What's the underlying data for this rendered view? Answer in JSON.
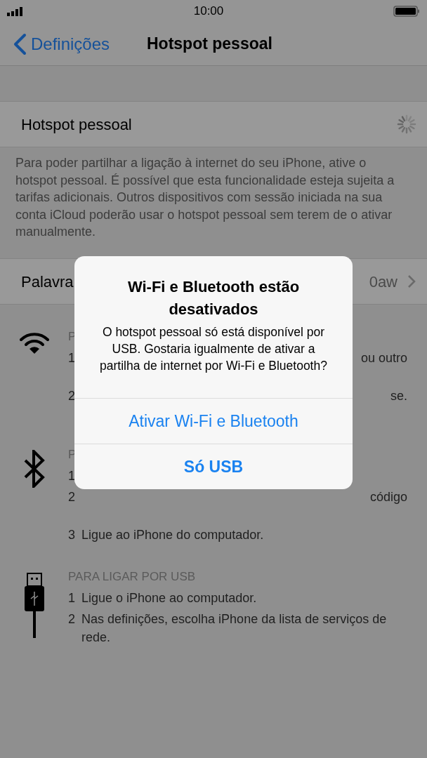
{
  "status_bar": {
    "time": "10:00"
  },
  "nav": {
    "back": "Definições",
    "title": "Hotspot pessoal"
  },
  "hotspot_cell": {
    "label": "Hotspot pessoal"
  },
  "description": "Para poder partilhar a ligação à internet do seu iPhone, ative o hotspot pessoal. É possível que esta funcionalidade esteja sujeita a tarifas adicionais. Outros dispositivos com sessão iniciada na sua conta iCloud poderão usar o hotspot pessoal sem terem de o ativar manualmente.",
  "password_cell": {
    "label": "Palavra",
    "value": "0aw"
  },
  "sections": [
    {
      "kind": "wifi",
      "items": [
        {
          "kind": "heading",
          "text": "P"
        },
        {
          "kind": "step",
          "number": "1",
          "end": "ou outro"
        },
        {
          "kind": "step",
          "number": "2",
          "end": "se."
        }
      ]
    },
    {
      "kind": "bluetooth",
      "items": [
        {
          "kind": "heading",
          "text": "P"
        },
        {
          "kind": "step",
          "number": "1"
        },
        {
          "kind": "step",
          "number": "2",
          "end": "código"
        },
        {
          "kind": "step",
          "number": "3",
          "text": "Ligue ao iPhone do computador."
        }
      ]
    },
    {
      "kind": "usb",
      "items": [
        {
          "kind": "heading",
          "text": "PARA LIGAR POR USB"
        },
        {
          "kind": "step",
          "number": "1",
          "text": "Ligue o iPhone ao computador."
        },
        {
          "kind": "step",
          "number": "2",
          "text": "Nas definições, escolha iPhone da lista de serviços de rede."
        }
      ]
    }
  ],
  "alert": {
    "title": "Wi-Fi e Bluetooth estão desativados",
    "message": "O hotspot pessoal só está disponível por USB. Gostaria igualmente de ativar a partilha de internet por Wi-Fi e Bluetooth?",
    "buttons": [
      {
        "label": "Ativar Wi-Fi e Bluetooth",
        "bold": false
      },
      {
        "label": "Só USB",
        "bold": true
      }
    ]
  }
}
